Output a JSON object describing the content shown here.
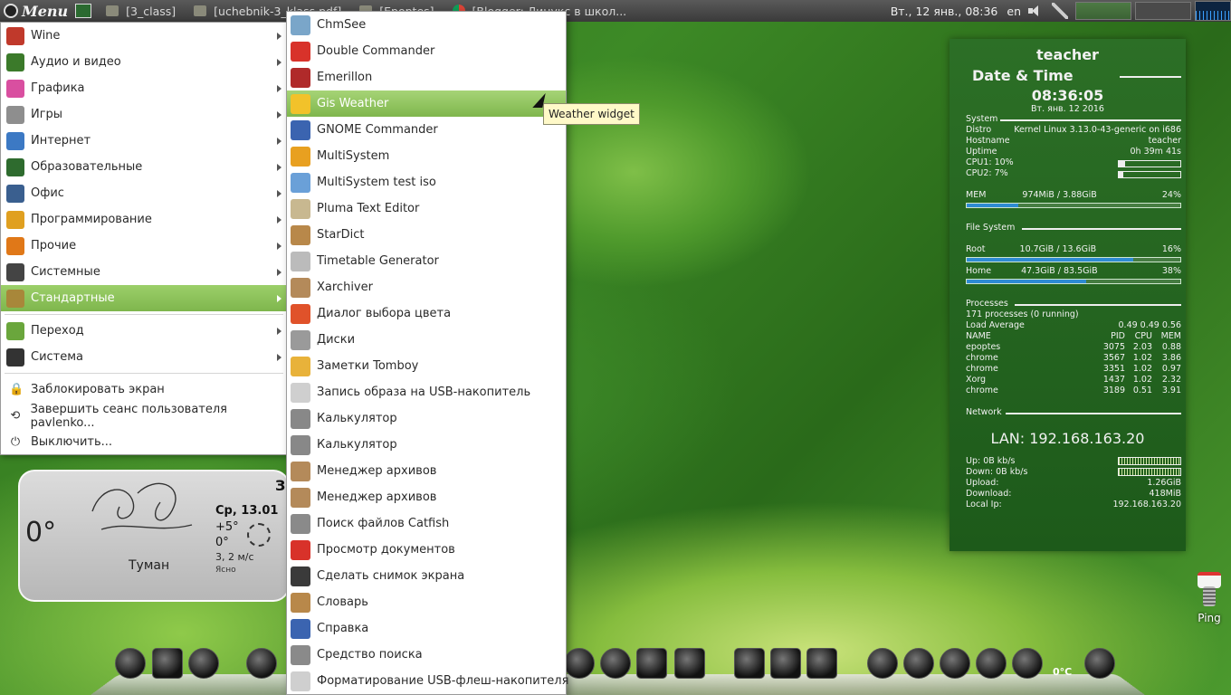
{
  "top_panel": {
    "menu_label": "Menu",
    "tasks": [
      {
        "label": "[3_class]",
        "icon": "folder-icon"
      },
      {
        "label": "[uchebnik-3_klass.pdf]",
        "icon": "document-icon"
      },
      {
        "label": "[Epoptes]",
        "icon": "window-icon"
      },
      {
        "label": "[Blogger: Линукс в школ...",
        "icon": "chrome-icon"
      }
    ],
    "clock": "Вт., 12 янв., 08:36",
    "lang": "en"
  },
  "main_menu": {
    "categories": [
      {
        "label": "Wine",
        "color": "#c0392b"
      },
      {
        "label": "Аудио и видео",
        "color": "#3b7a2a"
      },
      {
        "label": "Графика",
        "color": "#d94fa0"
      },
      {
        "label": "Игры",
        "color": "#8e8e8e"
      },
      {
        "label": "Интернет",
        "color": "#3c79c4"
      },
      {
        "label": "Образовательные",
        "color": "#2e6b2e"
      },
      {
        "label": "Офис",
        "color": "#3a5f8f"
      },
      {
        "label": "Программирование",
        "color": "#e0a020"
      },
      {
        "label": "Прочие",
        "color": "#e07818"
      },
      {
        "label": "Системные",
        "color": "#444444"
      },
      {
        "label": "Стандартные",
        "color": "#a8873a",
        "selected": true
      }
    ],
    "places": [
      {
        "label": "Переход",
        "color": "#6aa63c"
      },
      {
        "label": "Система",
        "color": "#333333"
      }
    ],
    "actions": [
      {
        "label": "Заблокировать экран",
        "icon": "lock-icon",
        "glyph": "🔒"
      },
      {
        "label": "Завершить сеанс пользователя pavlenko...",
        "icon": "logout-icon",
        "glyph": "⟲"
      },
      {
        "label": "Выключить...",
        "icon": "power-icon",
        "glyph": "⏻"
      }
    ]
  },
  "submenu": {
    "items": [
      {
        "label": "ChmSee",
        "color": "#7aa6c9"
      },
      {
        "label": "Double Commander",
        "color": "#d8322a"
      },
      {
        "label": "Emerillon",
        "color": "#b02a2a"
      },
      {
        "label": "Gis Weather",
        "color": "#f2c22a",
        "selected": true
      },
      {
        "label": "GNOME Commander",
        "color": "#3b64b0"
      },
      {
        "label": "MultiSystem",
        "color": "#e8a020"
      },
      {
        "label": "MultiSystem test iso",
        "color": "#6aa0d8"
      },
      {
        "label": "Pluma Text Editor",
        "color": "#c8b890"
      },
      {
        "label": "StarDict",
        "color": "#b8884a"
      },
      {
        "label": "Timetable Generator",
        "color": "#bbbbbb"
      },
      {
        "label": "Xarchiver",
        "color": "#b48a5a"
      },
      {
        "label": "Диалог выбора цвета",
        "color": "#e0522a"
      },
      {
        "label": "Диски",
        "color": "#9a9a9a"
      },
      {
        "label": "Заметки Tomboy",
        "color": "#e8b23a"
      },
      {
        "label": "Запись образа на USB-накопитель",
        "color": "#cfcfcf"
      },
      {
        "label": "Калькулятор",
        "color": "#888888"
      },
      {
        "label": "Калькулятор",
        "color": "#888888"
      },
      {
        "label": "Менеджер архивов",
        "color": "#b48a5a"
      },
      {
        "label": "Менеджер архивов",
        "color": "#b48a5a"
      },
      {
        "label": "Поиск файлов Catfish",
        "color": "#8a8a8a"
      },
      {
        "label": "Просмотр документов",
        "color": "#d8322a"
      },
      {
        "label": "Сделать снимок экрана",
        "color": "#3a3a3a"
      },
      {
        "label": "Словарь",
        "color": "#b8884a"
      },
      {
        "label": "Справка",
        "color": "#3b64b0"
      },
      {
        "label": "Средство поиска",
        "color": "#8a8a8a"
      },
      {
        "label": "Форматирование USB-флеш-накопителя",
        "color": "#cfcfcf"
      }
    ]
  },
  "tooltip": "Weather widget",
  "weather": {
    "temp": "0°",
    "condition": "Туман",
    "day": "Ср, 13.01",
    "hi": "+5°",
    "lo": "0°",
    "wind": "3, 2 м/с",
    "state": "Ясно",
    "corner": "За"
  },
  "conky": {
    "user": "teacher",
    "section_datetime": "Date & Time",
    "time": "08:36:05",
    "date": "Вт. янв. 12 2016",
    "system": {
      "heading": "System",
      "rows": [
        {
          "k": "Distro",
          "v": "Kernel Linux 3.13.0-43-generic on i686"
        },
        {
          "k": "Hostname",
          "v": "teacher"
        },
        {
          "k": "Uptime",
          "v": "0h 39m 41s"
        }
      ],
      "cpu1": {
        "label": "CPU1: 10%",
        "fill": 0.1
      },
      "cpu2": {
        "label": "CPU2: 7%",
        "fill": 0.07
      },
      "mem": {
        "label": "MEM",
        "value": "974MiB / 3.88GiB",
        "pct": "24%",
        "fill": 0.24
      }
    },
    "filesystem": {
      "heading": "File System",
      "root": {
        "label": "Root",
        "value": "10.7GiB / 13.6GiB",
        "pct": "16%",
        "fill": 0.78
      },
      "home": {
        "label": "Home",
        "value": "47.3GiB / 83.5GiB",
        "pct": "38%",
        "fill": 0.56
      }
    },
    "processes": {
      "heading": "Processes",
      "summary": "171 processes (0 running)",
      "load_label": "Load Average",
      "load_value": "0.49 0.49 0.56",
      "columns": [
        "NAME",
        "PID",
        "CPU",
        "MEM"
      ],
      "rows": [
        [
          "epoptes",
          "3075",
          "2.03",
          "0.88"
        ],
        [
          "chrome",
          "3567",
          "1.02",
          "3.86"
        ],
        [
          "chrome",
          "3351",
          "1.02",
          "0.97"
        ],
        [
          "Xorg",
          "1437",
          "1.02",
          "2.32"
        ],
        [
          "chrome",
          "3189",
          "0.51",
          "3.91"
        ]
      ]
    },
    "network": {
      "heading": "Network",
      "lan": "LAN: 192.168.163.20",
      "up": "Up: 0B   kb/s",
      "down": "Down: 0B   kb/s",
      "upload_label": "Upload:",
      "upload_value": "1.26GiB",
      "download_label": "Download:",
      "download_value": "418MiB",
      "localip_label": "Local Ip:",
      "localip_value": "192.168.163.20"
    }
  },
  "desktop": {
    "ping_label": "Ping"
  },
  "dock": {
    "temp_label": "0°C"
  }
}
